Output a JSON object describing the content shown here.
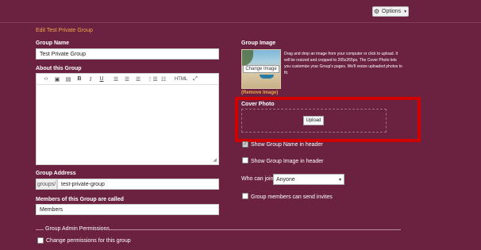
{
  "header": {
    "options_label": "Options",
    "section_title": "Edit Test Private Group"
  },
  "group_name": {
    "label": "Group Name",
    "value": "Test Private Group"
  },
  "about": {
    "label": "About this Group",
    "toolbar": [
      "code",
      "image",
      "media",
      "bold",
      "italic",
      "underline",
      "align-left",
      "align-center",
      "align-right",
      "bullet-list",
      "numbered-list",
      "HTML",
      "fullscreen"
    ],
    "html_label": "HTML"
  },
  "group_address": {
    "label": "Group Address",
    "prefix": "groups/",
    "value": "test-private-group"
  },
  "members_called": {
    "label": "Members of this Group are called",
    "value": "Members"
  },
  "group_image": {
    "label": "Group Image",
    "change_label": "Change Image",
    "remove_label": "(Remove Image)",
    "description": "Drag and drop an image from your computer or click to upload. It will be resized and cropped to 265x265px. The Cover Photo lets you customize your Group's pages. We'll resize uploaded photos to fit."
  },
  "cover_photo": {
    "label": "Cover Photo",
    "upload_label": "Upload"
  },
  "options": {
    "show_name_label": "Show Group Name in header",
    "show_name_checked": true,
    "show_image_label": "Show Group Image in header",
    "show_image_checked": false,
    "who_can_join_label": "Who can join?",
    "who_can_join_value": "Anyone",
    "send_invites_label": "Group members can send invites",
    "send_invites_checked": false
  },
  "permissions": {
    "section_label": "Group Admin Permissions",
    "change_label": "Change permissions for this group",
    "change_checked": false
  },
  "colors": {
    "background": "#6b2240",
    "accent": "#f0a848",
    "highlight": "#d00000"
  }
}
